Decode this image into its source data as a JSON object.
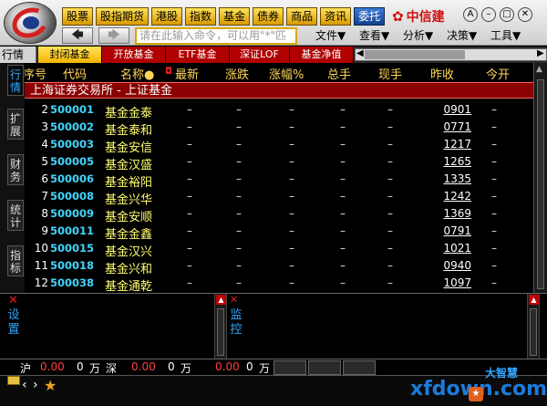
{
  "toolbar": {
    "nav": [
      "股票",
      "股指期货",
      "港股",
      "指数",
      "基金",
      "债券",
      "商品",
      "资讯",
      "委托"
    ],
    "brand": "中信建",
    "command_placeholder": "请在此输入命令，可以用\"*\"匹",
    "menu": [
      "文件▼",
      "查看▼",
      "分析▼",
      "决策▼",
      "工具▼"
    ]
  },
  "tabs": {
    "row_label": "行情",
    "items": [
      "封闭基金",
      "开放基金",
      "ETF基金",
      "深证LOF",
      "基金净值"
    ]
  },
  "side_tabs": [
    [
      "行",
      "情"
    ],
    [
      "扩",
      "展"
    ],
    [
      "财",
      "务"
    ],
    [
      "统",
      "计"
    ],
    [
      "指",
      "标"
    ]
  ],
  "table": {
    "headers": [
      "序号",
      "代码",
      "名称●",
      "最新",
      "涨跌",
      "涨幅%",
      "总手",
      "现手",
      "昨收",
      "今开"
    ],
    "section": "上海证券交易所 - 上证基金",
    "rows": [
      {
        "no": "2",
        "code": "500001",
        "name": "基金金泰",
        "prev": "0901"
      },
      {
        "no": "3",
        "code": "500002",
        "name": "基金泰和",
        "prev": "0771"
      },
      {
        "no": "4",
        "code": "500003",
        "name": "基金安信",
        "prev": "1217"
      },
      {
        "no": "5",
        "code": "500005",
        "name": "基金汉盛",
        "prev": "1265"
      },
      {
        "no": "6",
        "code": "500006",
        "name": "基金裕阳",
        "prev": "1335"
      },
      {
        "no": "7",
        "code": "500008",
        "name": "基金兴华",
        "prev": "1242"
      },
      {
        "no": "8",
        "code": "500009",
        "name": "基金安顺",
        "prev": "1369"
      },
      {
        "no": "9",
        "code": "500011",
        "name": "基金金鑫",
        "prev": "0791"
      },
      {
        "no": "10",
        "code": "500015",
        "name": "基金汉兴",
        "prev": "1021"
      },
      {
        "no": "11",
        "code": "500018",
        "name": "基金兴和",
        "prev": "0940"
      },
      {
        "no": "12",
        "code": "500038",
        "name": "基金通乾",
        "prev": "1097"
      }
    ],
    "dash": "–"
  },
  "bottom_panels": {
    "left_label": [
      "设",
      "置"
    ],
    "right_label": [
      "监",
      "控"
    ]
  },
  "status": {
    "sh_label": "沪",
    "sh_value": "0.00",
    "sh_count": "0",
    "sh_unit": "万",
    "sz_label": "深",
    "sz_value": "0.00",
    "sz_count": "0",
    "sz_unit": "万",
    "third_value": "0.00",
    "third_count": "0",
    "third_unit": "万",
    "brand_app": "大智慧",
    "watermark": "xfdown.com"
  },
  "colors": {
    "accent_yellow": "#ffd45a",
    "code_cyan": "#3fd6ff",
    "name_yellow": "#ffff70",
    "section_red": "#8b0000",
    "tab_red": "#b00000",
    "up_red": "#ff4040"
  }
}
